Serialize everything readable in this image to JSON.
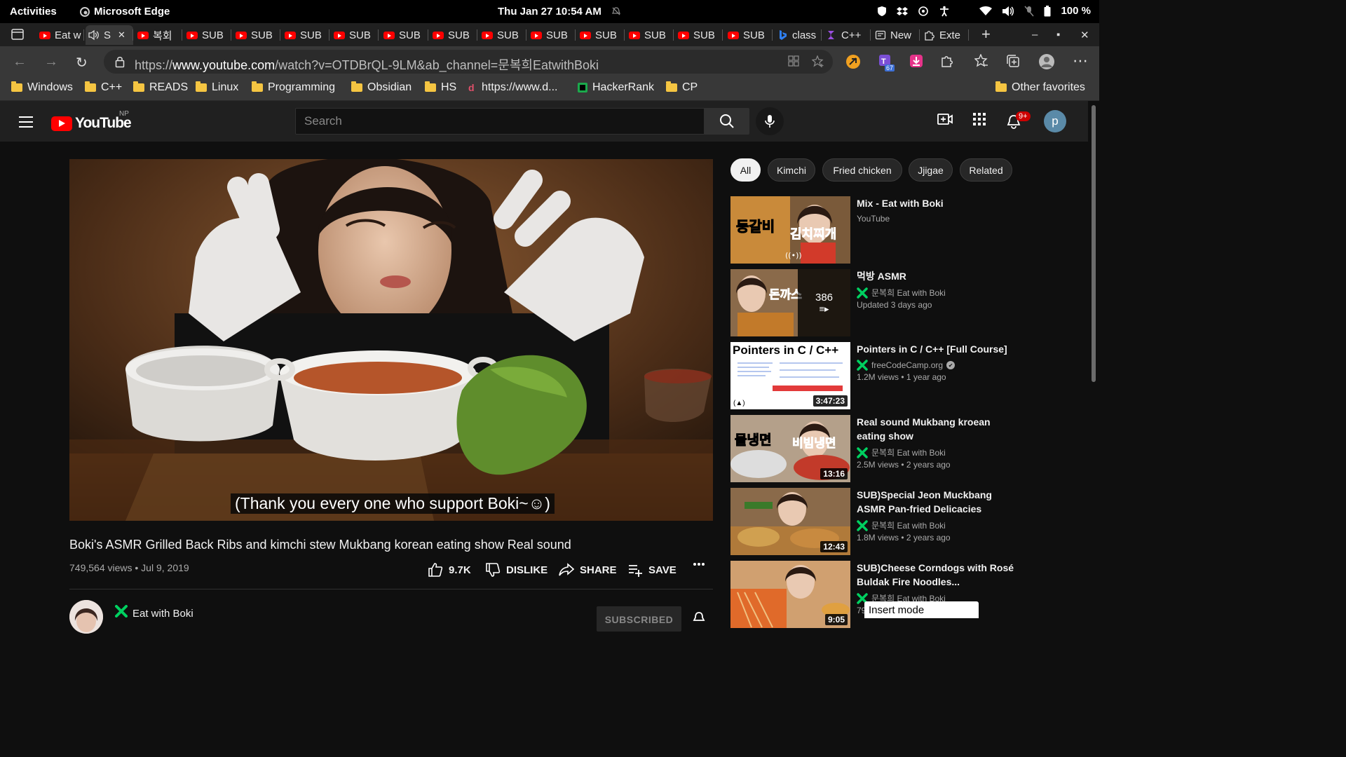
{
  "topbar": {
    "activities": "Activities",
    "app_name": "Microsoft Edge",
    "clock": "Thu Jan 27  10:54 AM",
    "battery": "100 %"
  },
  "tabs": [
    {
      "label": "Eat w",
      "icon": "youtube-icon"
    },
    {
      "label": "S",
      "icon": "speaker-icon",
      "active": true
    },
    {
      "label": "복회",
      "icon": "youtube-icon"
    },
    {
      "label": "SUB",
      "icon": "youtube-icon"
    },
    {
      "label": "SUB",
      "icon": "youtube-icon"
    },
    {
      "label": "SUB",
      "icon": "youtube-icon"
    },
    {
      "label": "SUB",
      "icon": "youtube-icon"
    },
    {
      "label": "SUB",
      "icon": "youtube-icon"
    },
    {
      "label": "SUB",
      "icon": "youtube-icon"
    },
    {
      "label": "SUB",
      "icon": "youtube-icon"
    },
    {
      "label": "SUB",
      "icon": "youtube-icon"
    },
    {
      "label": "SUB",
      "icon": "youtube-icon"
    },
    {
      "label": "SUB",
      "icon": "youtube-icon"
    },
    {
      "label": "SUB",
      "icon": "youtube-icon"
    },
    {
      "label": "SUB",
      "icon": "youtube-icon"
    },
    {
      "label": "class",
      "icon": "bing-icon"
    },
    {
      "label": "C++",
      "icon": "cpp-icon"
    },
    {
      "label": "New",
      "icon": "newtab-icon"
    },
    {
      "label": "Exte",
      "icon": "puzzle-icon"
    }
  ],
  "address": {
    "url_prefix": "https://",
    "url_host": "www.youtube.com",
    "url_path": "/watch?v=OTDBrQL-9LM&ab_channel=문복희EatwithBoki",
    "ext_badge": "67"
  },
  "bookmarks": [
    {
      "label": "Windows",
      "icon": "folder-icon"
    },
    {
      "label": "C++",
      "icon": "folder-icon"
    },
    {
      "label": "READS",
      "icon": "folder-icon"
    },
    {
      "label": "Linux",
      "icon": "folder-icon"
    },
    {
      "label": "Programming",
      "icon": "folder-icon"
    },
    {
      "label": "Obsidian",
      "icon": "folder-icon"
    },
    {
      "label": "HS",
      "icon": "folder-icon"
    },
    {
      "label": "https://www.d...",
      "icon": "site-icon"
    },
    {
      "label": "HackerRank",
      "icon": "hackerrank-icon"
    },
    {
      "label": "CP",
      "icon": "folder-icon"
    }
  ],
  "other_favorites": "Other favorites",
  "youtube": {
    "logo_text": "YouTube",
    "region": "NP",
    "search_placeholder": "Search",
    "notification_count": "9+",
    "avatar_letter": "p"
  },
  "video": {
    "caption": "(Thank you every one who support Boki~☺)",
    "title": "Boki's ASMR Grilled Back Ribs and kimchi stew Mukbang korean eating show Real sound",
    "meta": "749,564 views • Jul 9, 2019",
    "likes": "9.7K",
    "dislike": "DISLIKE",
    "share": "SHARE",
    "save": "SAVE",
    "channel": "Eat with Boki",
    "subscribe": "SUBSCRIBED"
  },
  "chips": [
    "All",
    "Kimchi",
    "Fried chicken",
    "Jjigae",
    "Related"
  ],
  "related": [
    {
      "title": "Mix - Eat with Boki",
      "channel": "YouTube",
      "meta": "",
      "duration": "",
      "thumb_text": "등갈비 김치찌개",
      "verified": false
    },
    {
      "title": "먹방 ASMR",
      "channel": "문복희 Eat with Boki",
      "meta": "Updated 3 days ago",
      "duration": "",
      "thumb_text": "돈까스",
      "playlist_count": "386",
      "verified": true
    },
    {
      "title": "Pointers in C / C++ [Full Course]",
      "channel": "freeCodeCamp.org",
      "meta": "1.2M views • 1 year ago",
      "duration": "3:47:23",
      "thumb_text": "Pointers in C / C++",
      "verified": true
    },
    {
      "title": "Real sound Mukbang kroean eating show",
      "channel": "문복희 Eat with Boki",
      "meta": "2.5M views • 2 years ago",
      "duration": "13:16",
      "thumb_text": "물냉면 비빔냉면",
      "verified": true
    },
    {
      "title": "SUB)Special Jeon Muckbang ASMR Pan-fried Delicacies",
      "channel": "문복희 Eat with Boki",
      "meta": "1.8M views • 2 years ago",
      "duration": "12:43",
      "thumb_text": "",
      "verified": true
    },
    {
      "title": "SUB)Cheese Corndogs with Rosé Buldak Fire Noodles...",
      "channel": "문복희 Eat with Boki",
      "meta": "79",
      "duration": "9:05",
      "thumb_text": "",
      "verified": true
    }
  ],
  "insert_mode": "Insert mode",
  "colors": {
    "youtube_red": "#ff0000",
    "verified_green": "#00d060",
    "background": "#0f0f0f"
  }
}
